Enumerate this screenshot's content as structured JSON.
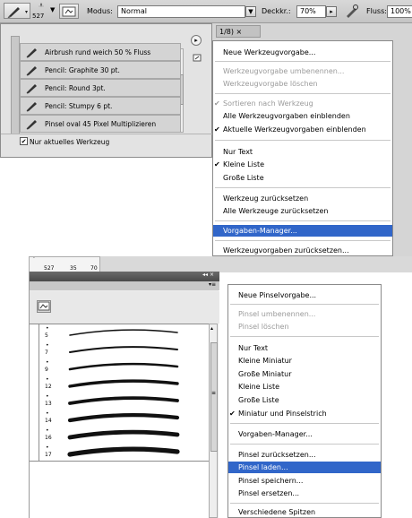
{
  "options_bar": {
    "brush_size": "527",
    "mode_label": "Modus:",
    "mode_value": "Normal",
    "opacity_label": "Deckkr.:",
    "opacity_value": "70%",
    "flow_label": "Fluss:",
    "flow_value": "100%"
  },
  "top_tab_label": "1/8) ×",
  "presets": [
    "Airbrush rund weich 50 % Fluss",
    "Pencil: Graphite 30 pt.",
    "Pencil: Round 3pt.",
    "Pencil: Stumpy 6 pt.",
    "Pinsel oval 45 Pixel Multiplizieren"
  ],
  "current_tool_only_label": "Nur aktuelles Werkzeug",
  "tool_menu": {
    "items": [
      {
        "label": "Neue Werkzeugvorgabe...",
        "state": "normal"
      },
      {
        "label": "Werkzeugvorgabe umbenennen...",
        "state": "disabled"
      },
      {
        "label": "Werkzeugvorgabe löschen",
        "state": "disabled"
      },
      {
        "label": "Sortieren nach Werkzeug",
        "state": "disabled",
        "checked": true
      },
      {
        "label": "Alle Werkzeugvorgaben einblenden",
        "state": "normal"
      },
      {
        "label": "Aktuelle Werkzeugvorgaben einblenden",
        "state": "normal",
        "checked": true
      },
      {
        "label": "Nur Text",
        "state": "normal"
      },
      {
        "label": "Kleine Liste",
        "state": "normal",
        "checked": true
      },
      {
        "label": "Große Liste",
        "state": "normal"
      },
      {
        "label": "Werkzeug zurücksetzen",
        "state": "normal"
      },
      {
        "label": "Alle Werkzeuge zurücksetzen",
        "state": "normal"
      },
      {
        "label": "Vorgaben-Manager...",
        "state": "highlighted"
      },
      {
        "label": "Werkzeugvorgaben zurücksetzen...",
        "state": "normal"
      }
    ]
  },
  "strip_numbers": [
    "527",
    "35",
    "70"
  ],
  "panel_controls": "◂◂ ×",
  "brush_sizes": [
    "5",
    "7",
    "9",
    "12",
    "13",
    "14",
    "16",
    "17"
  ],
  "brush_menu": {
    "items": [
      {
        "label": "Neue Pinselvorgabe...",
        "state": "normal"
      },
      {
        "label": "Pinsel umbenennen...",
        "state": "disabled"
      },
      {
        "label": "Pinsel löschen",
        "state": "disabled"
      },
      {
        "label": "Nur Text",
        "state": "normal"
      },
      {
        "label": "Kleine Miniatur",
        "state": "normal"
      },
      {
        "label": "Große Miniatur",
        "state": "normal"
      },
      {
        "label": "Kleine Liste",
        "state": "normal"
      },
      {
        "label": "Große Liste",
        "state": "normal"
      },
      {
        "label": "Miniatur und Pinselstrich",
        "state": "normal",
        "checked": true
      },
      {
        "label": "Vorgaben-Manager...",
        "state": "normal"
      },
      {
        "label": "Pinsel zurücksetzen...",
        "state": "normal"
      },
      {
        "label": "Pinsel laden...",
        "state": "highlighted"
      },
      {
        "label": "Pinsel speichern...",
        "state": "normal"
      },
      {
        "label": "Pinsel ersetzen...",
        "state": "normal"
      },
      {
        "label": "Verschiedene Spitzen",
        "state": "normal"
      }
    ]
  },
  "colors": {
    "highlight": "#3166c9",
    "panel_bg": "#e3e3e3",
    "disabled_text": "#9a9a9a"
  }
}
